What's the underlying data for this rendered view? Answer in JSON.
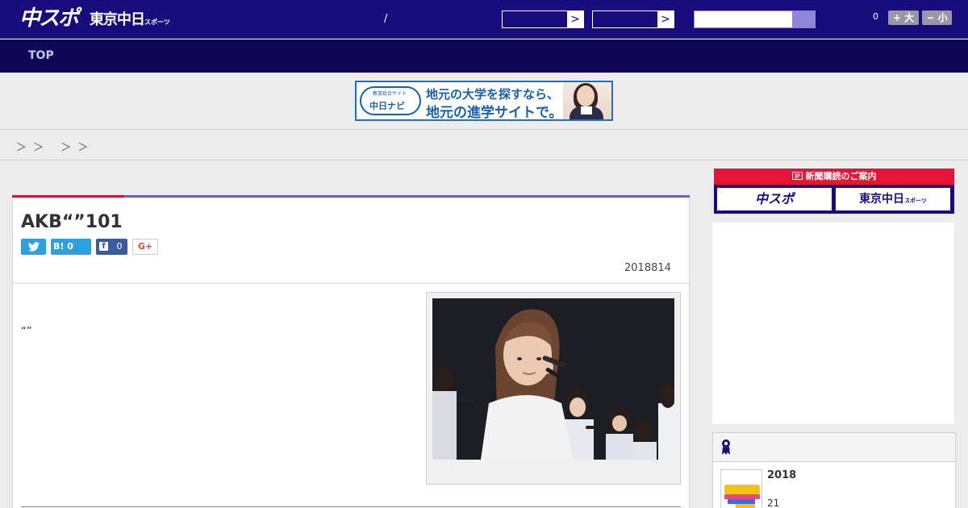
{
  "header": {
    "logo_primary": "中スポ",
    "logo_secondary": "東京中日",
    "logo_secondary_small": "スポーツ",
    "slash": "/",
    "select_arrow": ">",
    "counter": "0",
    "font_larger": "+ 大",
    "font_smaller": "− 小"
  },
  "nav": {
    "top_label": "TOP"
  },
  "banner": {
    "logo_top": "教育総合サイト",
    "logo_main": "中日ナビ",
    "text_line1": "地元の大学を探すなら、",
    "text_line2": "地元の進学サイトで。"
  },
  "breadcrumb": "＞ ＞　 ＞ ＞",
  "article": {
    "title": "AKB“”101",
    "share_hatena": "B! 0",
    "share_facebook_icon": "f",
    "share_facebook_count": "0",
    "share_gplus": "G+",
    "date": "2018814",
    "body": "“”"
  },
  "sidebar": {
    "subscribe_heading": "新聞購読のご案内",
    "subscribe_btn_1": "中スポ",
    "subscribe_btn_2": "東京中日",
    "subscribe_btn_2_small": "スポーツ",
    "ranking_item_title": "2018",
    "ranking_item_sub": "21"
  },
  "colors": {
    "header_bg": "#190c7c",
    "nav_bg": "#100658",
    "accent_red": "#e0102f",
    "accent_purple": "#6b62bf"
  }
}
